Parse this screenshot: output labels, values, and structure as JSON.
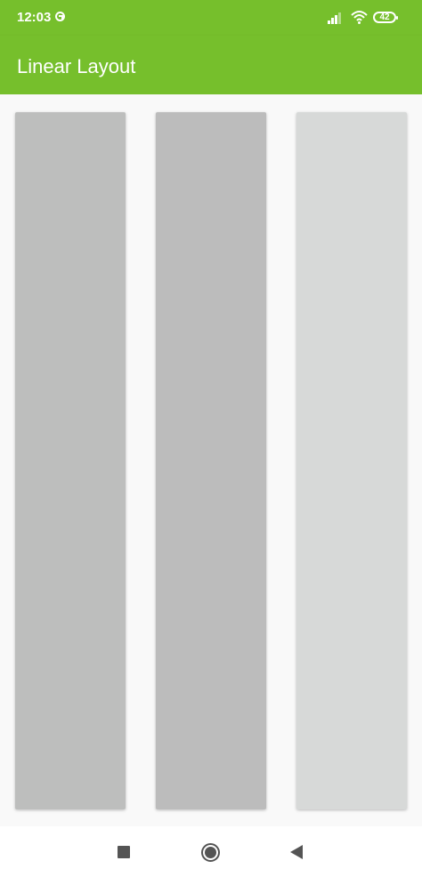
{
  "status_bar": {
    "time": "12:03",
    "battery": "42",
    "icons": [
      "sync-icon",
      "signal-icon",
      "wifi-icon",
      "battery-icon"
    ]
  },
  "app_bar": {
    "title": "Linear Layout",
    "color": "#76bf2c"
  },
  "content": {
    "background": "#f9f9f9",
    "panels": [
      {
        "name": "panel-1",
        "color": "#bdbebd"
      },
      {
        "name": "panel-2",
        "color": "#bcbcbc"
      },
      {
        "name": "panel-3",
        "color": "#d7d9d8"
      }
    ]
  },
  "nav_bar": {
    "buttons": [
      "recents-button",
      "home-button",
      "back-button"
    ]
  }
}
